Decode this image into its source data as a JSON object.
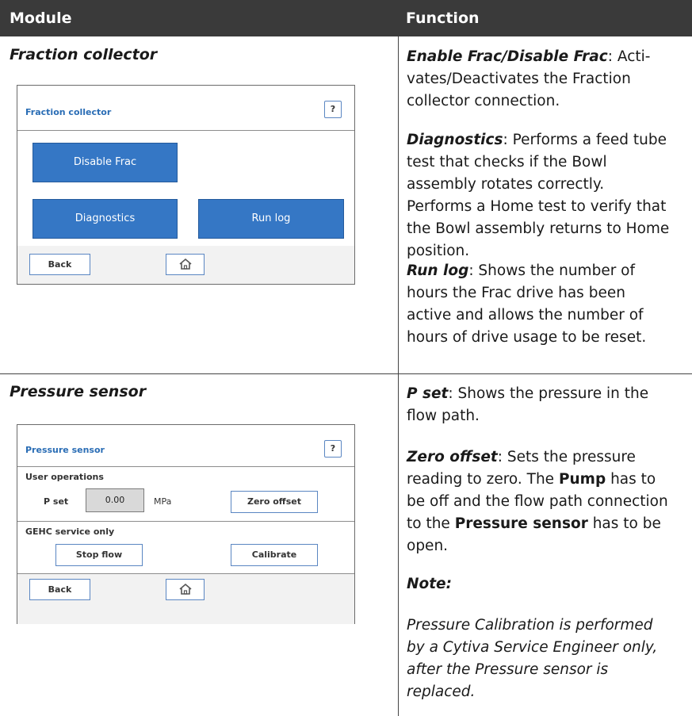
{
  "table": {
    "header": {
      "module": "Module",
      "function": "Function"
    },
    "rows": [
      {
        "module_title": "Fraction collector",
        "screen": {
          "title": "Fraction collector",
          "help": "?",
          "buttons": {
            "disable_frac": "Disable Frac",
            "diagnostics": "Diagnostics",
            "run_log": "Run log"
          },
          "back": "Back"
        },
        "functions": {
          "enable": {
            "term": "Enable Frac/Disable Frac",
            "line1": ": Acti-",
            "line2": "vates/Deactivates the Fraction",
            "line3": "collector connection."
          },
          "diagnostics": {
            "term": "Diagnostics",
            "line1": ": Performs a feed tube",
            "line2": "test that checks if the Bowl",
            "line3": "assembly rotates correctly.",
            "line4": "Performs a Home test to verify that",
            "line5": "the Bowl assembly returns to Home",
            "line6": "position."
          },
          "run_log": {
            "term": "Run log",
            "line1": ": Shows the number of",
            "line2": "hours the Frac drive has been",
            "line3": "active and allows the number of",
            "line4": "hours of drive usage to be reset."
          }
        }
      },
      {
        "module_title": "Pressure sensor",
        "screen": {
          "title": "Pressure sensor",
          "help": "?",
          "user_ops": "User operations",
          "p_set_label": "P set",
          "p_set_value": "0.00",
          "unit": "MPa",
          "zero_offset": "Zero offset",
          "gehc": "GEHC service only",
          "stop_flow": "Stop flow",
          "calibrate": "Calibrate",
          "back": "Back"
        },
        "functions": {
          "p_set": {
            "term": "P set",
            "line1": ": Shows the pressure in the",
            "line2": "flow path."
          },
          "zero_offset": {
            "term": "Zero offset",
            "line1": ": Sets the pressure",
            "line2a": "reading to zero. The ",
            "pump": "Pump",
            "line2b": " has to",
            "line3": "be off and the flow path connection",
            "line4a": "to the ",
            "sensor": "Pressure sensor",
            "line4b": " has to be",
            "line5": "open."
          },
          "note_heading": "Note:",
          "note": {
            "line1": "Pressure Calibration is performed",
            "line2": "by a Cytiva Service Engineer only,",
            "line3": "after the Pressure sensor is",
            "line4": "replaced."
          }
        }
      }
    ]
  }
}
